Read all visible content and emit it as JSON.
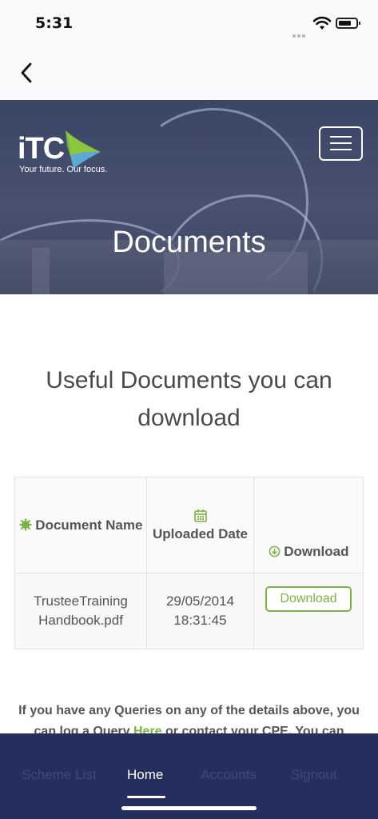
{
  "status_bar": {
    "time": "5:31"
  },
  "header": {
    "logo_text": "iTC",
    "tagline": "Your future. Our focus.",
    "page_title": "Documents"
  },
  "main": {
    "heading": "Useful Documents you can download",
    "table": {
      "headers": {
        "name": "Document Name",
        "date": "Uploaded Date",
        "download": "Download"
      },
      "rows": [
        {
          "name": "TrusteeTraining Handbook.pdf",
          "date": "29/05/2014 18:31:45",
          "action": "Download"
        }
      ]
    },
    "queries": {
      "text_before": "If you have any Queries on any of the details above, you can log a Query ",
      "link": "Here",
      "text_after": " or contact your CPE. You can"
    }
  },
  "tabs": [
    {
      "label": "Scheme List"
    },
    {
      "label": "Home"
    },
    {
      "label": "Accounts"
    },
    {
      "label": "Signout"
    }
  ],
  "colors": {
    "accent": "#7cb342",
    "tabbar": "#252f5e",
    "hero": "#444c6b"
  }
}
